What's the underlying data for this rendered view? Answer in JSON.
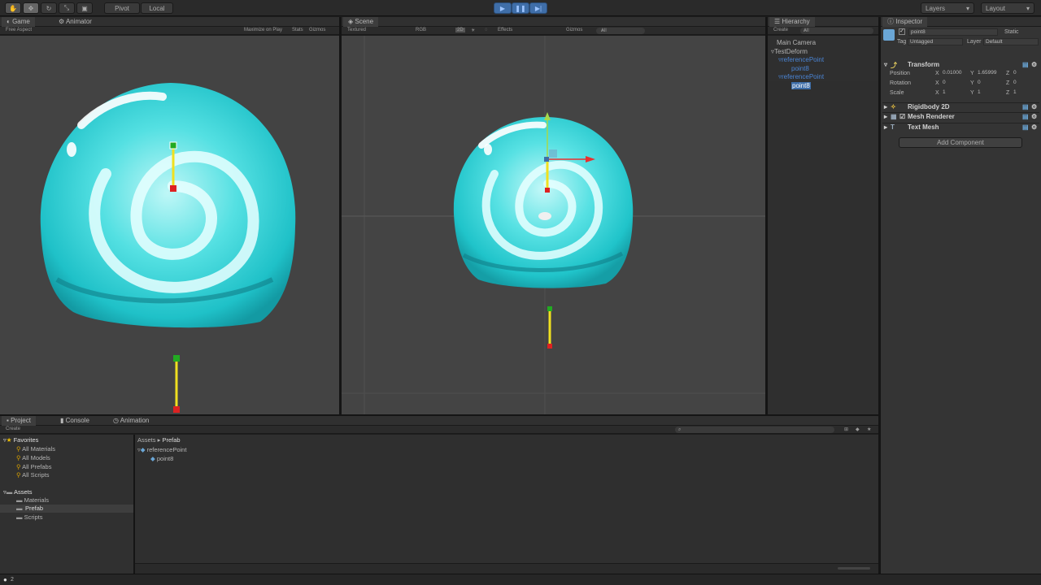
{
  "toolbar": {
    "pivot": "Pivot",
    "local": "Local",
    "layers": "Layers",
    "layout": "Layout"
  },
  "game": {
    "tab_game": "Game",
    "tab_animator": "Animator",
    "aspect": "Free Aspect",
    "maximize": "Maximize on Play",
    "stats": "Stats",
    "gizmos": "Gizmos"
  },
  "scene": {
    "tab": "Scene",
    "shading": "Textured",
    "rgb": "RGB",
    "mode2d": "2D",
    "effects": "Effects",
    "gizmos": "Gizmos",
    "search": "All"
  },
  "hierarchy": {
    "tab": "Hierarchy",
    "create": "Create",
    "search": "All",
    "items": [
      "Main Camera",
      "TestDeform",
      "referencePoint",
      "point8",
      "referencePoint",
      "point8"
    ]
  },
  "inspector": {
    "tab": "Inspector",
    "object_name": "point8",
    "static": "Static",
    "tag_label": "Tag",
    "tag_value": "Untagged",
    "layer_label": "Layer",
    "layer_value": "Default",
    "transform": "Transform",
    "position_label": "Position",
    "rotation_label": "Rotation",
    "scale_label": "Scale",
    "x": "X",
    "y": "Y",
    "z": "Z",
    "pos_x": "0.01000",
    "pos_y": "1.65999",
    "pos_z": "0",
    "rot_x": "0",
    "rot_y": "0",
    "rot_z": "0",
    "scale_x": "1",
    "scale_y": "1",
    "scale_z": "1",
    "rigidbody": "Rigidbody 2D",
    "mesh_renderer": "Mesh Renderer",
    "text_mesh": "Text Mesh",
    "add_component": "Add Component"
  },
  "project": {
    "tab_project": "Project",
    "tab_console": "Console",
    "tab_animation": "Animation",
    "create": "Create",
    "favorites": "Favorites",
    "fav_items": [
      "All Materials",
      "All Models",
      "All Prefabs",
      "All Scripts"
    ],
    "assets": "Assets",
    "asset_folders": [
      "Materials",
      "Prefab",
      "Scripts"
    ],
    "breadcrumb_root": "Assets",
    "breadcrumb_sep": "▸",
    "breadcrumb_leaf": "Prefab",
    "files": [
      "referencePoint",
      "point8"
    ]
  },
  "status": {
    "count": "2"
  },
  "colors": {
    "accent": "#3f6ea8",
    "cyan": "#2fd3d8",
    "selection": "#3d6da8"
  }
}
